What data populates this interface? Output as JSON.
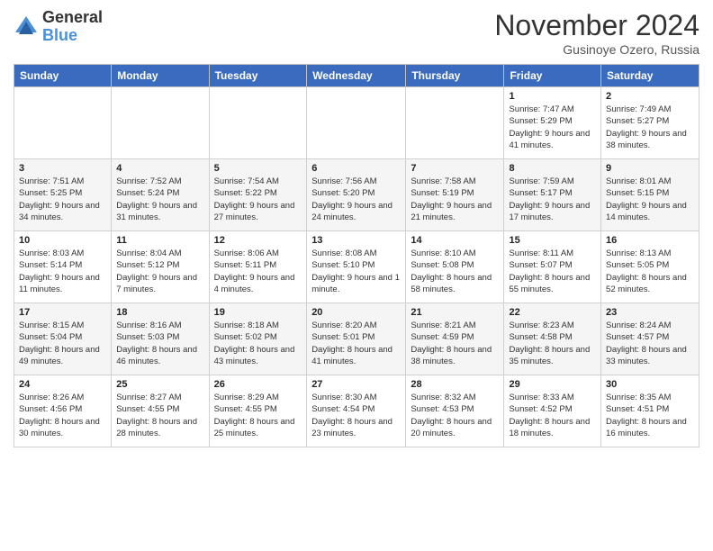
{
  "header": {
    "logo_general": "General",
    "logo_blue": "Blue",
    "month_title": "November 2024",
    "location": "Gusinoye Ozero, Russia"
  },
  "weekdays": [
    "Sunday",
    "Monday",
    "Tuesday",
    "Wednesday",
    "Thursday",
    "Friday",
    "Saturday"
  ],
  "weeks": [
    [
      {
        "day": "",
        "info": ""
      },
      {
        "day": "",
        "info": ""
      },
      {
        "day": "",
        "info": ""
      },
      {
        "day": "",
        "info": ""
      },
      {
        "day": "",
        "info": ""
      },
      {
        "day": "1",
        "info": "Sunrise: 7:47 AM\nSunset: 5:29 PM\nDaylight: 9 hours and 41 minutes."
      },
      {
        "day": "2",
        "info": "Sunrise: 7:49 AM\nSunset: 5:27 PM\nDaylight: 9 hours and 38 minutes."
      }
    ],
    [
      {
        "day": "3",
        "info": "Sunrise: 7:51 AM\nSunset: 5:25 PM\nDaylight: 9 hours and 34 minutes."
      },
      {
        "day": "4",
        "info": "Sunrise: 7:52 AM\nSunset: 5:24 PM\nDaylight: 9 hours and 31 minutes."
      },
      {
        "day": "5",
        "info": "Sunrise: 7:54 AM\nSunset: 5:22 PM\nDaylight: 9 hours and 27 minutes."
      },
      {
        "day": "6",
        "info": "Sunrise: 7:56 AM\nSunset: 5:20 PM\nDaylight: 9 hours and 24 minutes."
      },
      {
        "day": "7",
        "info": "Sunrise: 7:58 AM\nSunset: 5:19 PM\nDaylight: 9 hours and 21 minutes."
      },
      {
        "day": "8",
        "info": "Sunrise: 7:59 AM\nSunset: 5:17 PM\nDaylight: 9 hours and 17 minutes."
      },
      {
        "day": "9",
        "info": "Sunrise: 8:01 AM\nSunset: 5:15 PM\nDaylight: 9 hours and 14 minutes."
      }
    ],
    [
      {
        "day": "10",
        "info": "Sunrise: 8:03 AM\nSunset: 5:14 PM\nDaylight: 9 hours and 11 minutes."
      },
      {
        "day": "11",
        "info": "Sunrise: 8:04 AM\nSunset: 5:12 PM\nDaylight: 9 hours and 7 minutes."
      },
      {
        "day": "12",
        "info": "Sunrise: 8:06 AM\nSunset: 5:11 PM\nDaylight: 9 hours and 4 minutes."
      },
      {
        "day": "13",
        "info": "Sunrise: 8:08 AM\nSunset: 5:10 PM\nDaylight: 9 hours and 1 minute."
      },
      {
        "day": "14",
        "info": "Sunrise: 8:10 AM\nSunset: 5:08 PM\nDaylight: 8 hours and 58 minutes."
      },
      {
        "day": "15",
        "info": "Sunrise: 8:11 AM\nSunset: 5:07 PM\nDaylight: 8 hours and 55 minutes."
      },
      {
        "day": "16",
        "info": "Sunrise: 8:13 AM\nSunset: 5:05 PM\nDaylight: 8 hours and 52 minutes."
      }
    ],
    [
      {
        "day": "17",
        "info": "Sunrise: 8:15 AM\nSunset: 5:04 PM\nDaylight: 8 hours and 49 minutes."
      },
      {
        "day": "18",
        "info": "Sunrise: 8:16 AM\nSunset: 5:03 PM\nDaylight: 8 hours and 46 minutes."
      },
      {
        "day": "19",
        "info": "Sunrise: 8:18 AM\nSunset: 5:02 PM\nDaylight: 8 hours and 43 minutes."
      },
      {
        "day": "20",
        "info": "Sunrise: 8:20 AM\nSunset: 5:01 PM\nDaylight: 8 hours and 41 minutes."
      },
      {
        "day": "21",
        "info": "Sunrise: 8:21 AM\nSunset: 4:59 PM\nDaylight: 8 hours and 38 minutes."
      },
      {
        "day": "22",
        "info": "Sunrise: 8:23 AM\nSunset: 4:58 PM\nDaylight: 8 hours and 35 minutes."
      },
      {
        "day": "23",
        "info": "Sunrise: 8:24 AM\nSunset: 4:57 PM\nDaylight: 8 hours and 33 minutes."
      }
    ],
    [
      {
        "day": "24",
        "info": "Sunrise: 8:26 AM\nSunset: 4:56 PM\nDaylight: 8 hours and 30 minutes."
      },
      {
        "day": "25",
        "info": "Sunrise: 8:27 AM\nSunset: 4:55 PM\nDaylight: 8 hours and 28 minutes."
      },
      {
        "day": "26",
        "info": "Sunrise: 8:29 AM\nSunset: 4:55 PM\nDaylight: 8 hours and 25 minutes."
      },
      {
        "day": "27",
        "info": "Sunrise: 8:30 AM\nSunset: 4:54 PM\nDaylight: 8 hours and 23 minutes."
      },
      {
        "day": "28",
        "info": "Sunrise: 8:32 AM\nSunset: 4:53 PM\nDaylight: 8 hours and 20 minutes."
      },
      {
        "day": "29",
        "info": "Sunrise: 8:33 AM\nSunset: 4:52 PM\nDaylight: 8 hours and 18 minutes."
      },
      {
        "day": "30",
        "info": "Sunrise: 8:35 AM\nSunset: 4:51 PM\nDaylight: 8 hours and 16 minutes."
      }
    ]
  ]
}
